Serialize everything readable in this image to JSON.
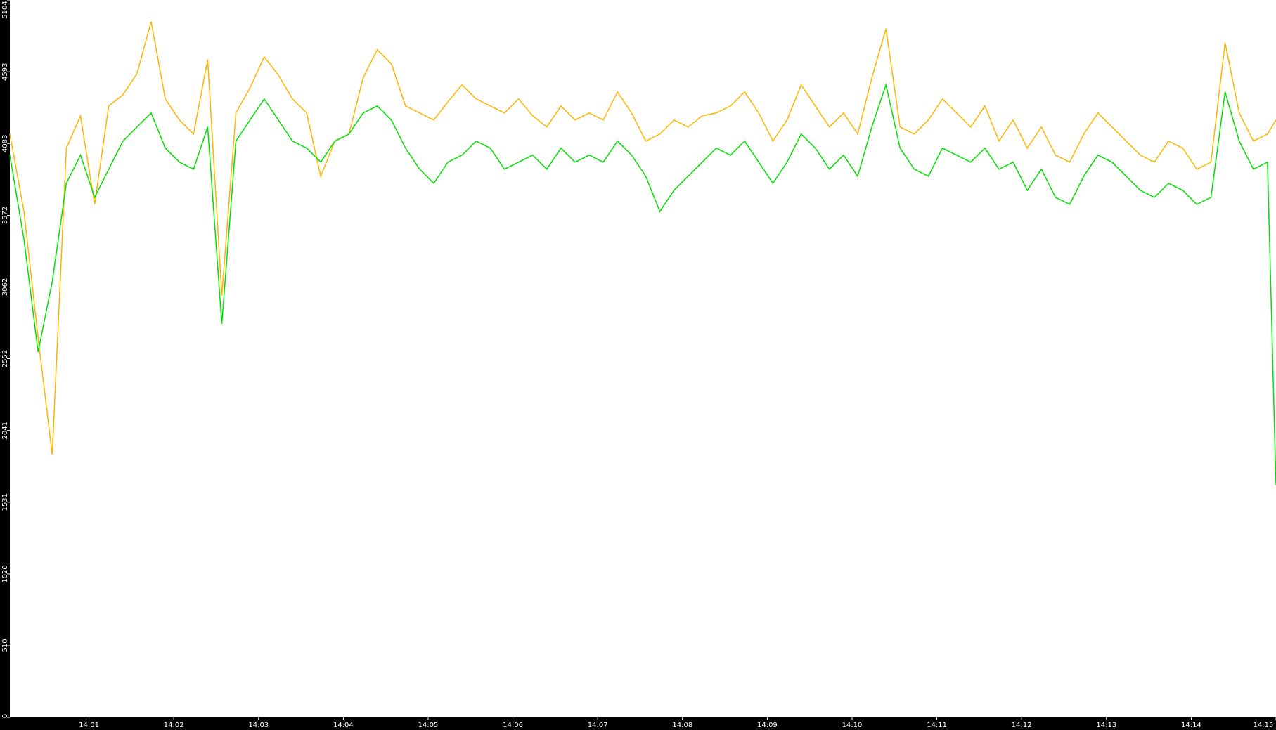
{
  "chart_data": {
    "type": "line",
    "title": "",
    "xlabel": "",
    "ylabel": "",
    "ylim": [
      0,
      5104
    ],
    "yticks": [
      0,
      510,
      1020,
      1531,
      2041,
      2552,
      3062,
      3572,
      4083,
      4593,
      5104
    ],
    "x_start": "14:00:04",
    "x_end": "14:15:00",
    "xticks": [
      "14:01",
      "14:02",
      "14:03",
      "14:04",
      "14:05",
      "14:06",
      "14:07",
      "14:08",
      "14:09",
      "14:10",
      "14:11",
      "14:12",
      "14:13",
      "14:14",
      "14:15"
    ],
    "grid": false,
    "legend": "none",
    "series": [
      {
        "color": "#ffb400",
        "x": [
          "14:00:04",
          "14:00:14",
          "14:00:24",
          "14:00:34",
          "14:00:44",
          "14:00:54",
          "14:01:04",
          "14:01:14",
          "14:01:24",
          "14:01:34",
          "14:01:44",
          "14:01:54",
          "14:02:04",
          "14:02:14",
          "14:02:24",
          "14:02:34",
          "14:02:44",
          "14:02:54",
          "14:03:04",
          "14:03:14",
          "14:03:24",
          "14:03:34",
          "14:03:44",
          "14:03:54",
          "14:04:04",
          "14:04:14",
          "14:04:24",
          "14:04:34",
          "14:04:44",
          "14:04:54",
          "14:05:04",
          "14:05:14",
          "14:05:24",
          "14:05:34",
          "14:05:44",
          "14:05:54",
          "14:06:04",
          "14:06:14",
          "14:06:24",
          "14:06:34",
          "14:06:44",
          "14:06:54",
          "14:07:04",
          "14:07:14",
          "14:07:24",
          "14:07:34",
          "14:07:44",
          "14:07:54",
          "14:08:04",
          "14:08:14",
          "14:08:24",
          "14:08:34",
          "14:08:44",
          "14:08:54",
          "14:09:04",
          "14:09:14",
          "14:09:24",
          "14:09:34",
          "14:09:44",
          "14:09:54",
          "14:10:04",
          "14:10:14",
          "14:10:24",
          "14:10:34",
          "14:10:44",
          "14:10:54",
          "14:11:04",
          "14:11:14",
          "14:11:24",
          "14:11:34",
          "14:11:44",
          "14:11:54",
          "14:12:04",
          "14:12:14",
          "14:12:24",
          "14:12:34",
          "14:12:44",
          "14:12:54",
          "14:13:04",
          "14:13:14",
          "14:13:24",
          "14:13:34",
          "14:13:44",
          "14:13:54",
          "14:14:04",
          "14:14:14",
          "14:14:24",
          "14:14:34",
          "14:14:44",
          "14:14:54",
          "14:15:00"
        ],
        "values": [
          4150,
          3600,
          2700,
          1870,
          4050,
          4280,
          3650,
          4350,
          4430,
          4580,
          4950,
          4400,
          4250,
          4150,
          4680,
          3000,
          4300,
          4480,
          4700,
          4570,
          4400,
          4300,
          3850,
          4100,
          4150,
          4550,
          4750,
          4650,
          4350,
          4300,
          4250,
          4380,
          4500,
          4400,
          4350,
          4300,
          4400,
          4280,
          4200,
          4350,
          4250,
          4300,
          4250,
          4450,
          4300,
          4100,
          4150,
          4250,
          4200,
          4280,
          4300,
          4350,
          4450,
          4300,
          4100,
          4250,
          4500,
          4350,
          4200,
          4300,
          4150,
          4550,
          4900,
          4200,
          4150,
          4250,
          4400,
          4300,
          4200,
          4350,
          4100,
          4250,
          4050,
          4200,
          4000,
          3950,
          4150,
          4300,
          4200,
          4100,
          4000,
          3950,
          4100,
          4050,
          3900,
          3950,
          4800,
          4300,
          4100,
          4150,
          4250
        ]
      },
      {
        "color": "#00e000",
        "x": [
          "14:00:04",
          "14:00:14",
          "14:00:24",
          "14:00:34",
          "14:00:44",
          "14:00:54",
          "14:01:04",
          "14:01:14",
          "14:01:24",
          "14:01:34",
          "14:01:44",
          "14:01:54",
          "14:02:04",
          "14:02:14",
          "14:02:24",
          "14:02:34",
          "14:02:44",
          "14:02:54",
          "14:03:04",
          "14:03:14",
          "14:03:24",
          "14:03:34",
          "14:03:44",
          "14:03:54",
          "14:04:04",
          "14:04:14",
          "14:04:24",
          "14:04:34",
          "14:04:44",
          "14:04:54",
          "14:05:04",
          "14:05:14",
          "14:05:24",
          "14:05:34",
          "14:05:44",
          "14:05:54",
          "14:06:04",
          "14:06:14",
          "14:06:24",
          "14:06:34",
          "14:06:44",
          "14:06:54",
          "14:07:04",
          "14:07:14",
          "14:07:24",
          "14:07:34",
          "14:07:44",
          "14:07:54",
          "14:08:04",
          "14:08:14",
          "14:08:24",
          "14:08:34",
          "14:08:44",
          "14:08:54",
          "14:09:04",
          "14:09:14",
          "14:09:24",
          "14:09:34",
          "14:09:44",
          "14:09:54",
          "14:10:04",
          "14:10:14",
          "14:10:24",
          "14:10:34",
          "14:10:44",
          "14:10:54",
          "14:11:04",
          "14:11:14",
          "14:11:24",
          "14:11:34",
          "14:11:44",
          "14:11:54",
          "14:12:04",
          "14:12:14",
          "14:12:24",
          "14:12:34",
          "14:12:44",
          "14:12:54",
          "14:13:04",
          "14:13:14",
          "14:13:24",
          "14:13:34",
          "14:13:44",
          "14:13:54",
          "14:14:04",
          "14:14:14",
          "14:14:24",
          "14:14:34",
          "14:14:44",
          "14:14:54",
          "14:15:00"
        ],
        "values": [
          4000,
          3400,
          2600,
          3100,
          3800,
          4000,
          3700,
          3900,
          4100,
          4200,
          4300,
          4050,
          3950,
          3900,
          4200,
          2800,
          4100,
          4250,
          4400,
          4250,
          4100,
          4050,
          3950,
          4100,
          4150,
          4300,
          4350,
          4250,
          4050,
          3900,
          3800,
          3950,
          4000,
          4100,
          4050,
          3900,
          3950,
          4000,
          3900,
          4050,
          3950,
          4000,
          3950,
          4100,
          4000,
          3850,
          3600,
          3750,
          3850,
          3950,
          4050,
          4000,
          4100,
          3950,
          3800,
          3950,
          4150,
          4050,
          3900,
          4000,
          3850,
          4200,
          4500,
          4050,
          3900,
          3850,
          4050,
          4000,
          3950,
          4050,
          3900,
          3950,
          3750,
          3900,
          3700,
          3650,
          3850,
          4000,
          3950,
          3850,
          3750,
          3700,
          3800,
          3750,
          3650,
          3700,
          4450,
          4100,
          3900,
          3950,
          1650
        ]
      }
    ]
  }
}
